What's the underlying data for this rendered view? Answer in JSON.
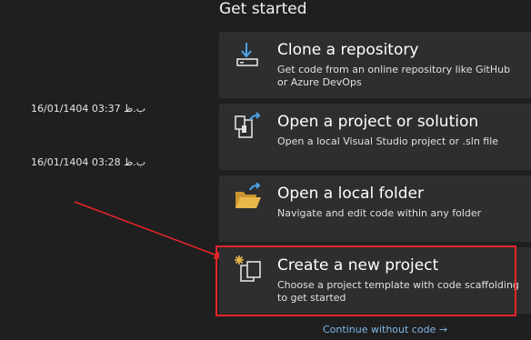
{
  "get_started": {
    "title": "Get started",
    "cards": [
      {
        "title": "Clone a repository",
        "desc": "Get code from an online repository like GitHub or Azure DevOps",
        "icon": "clone-download-icon"
      },
      {
        "title": "Open a project or solution",
        "desc": "Open a local Visual Studio project or .sln file",
        "icon": "open-project-icon"
      },
      {
        "title": "Open a local folder",
        "desc": "Navigate and edit code within any folder",
        "icon": "open-folder-icon"
      },
      {
        "title": "Create a new project",
        "desc": "Choose a project template with code scaffolding to get started",
        "icon": "new-project-icon"
      }
    ],
    "continue_label": "Continue without code →"
  },
  "recent": [
    {
      "timestamp": "16/01/1404 03:37 ب.ظ"
    },
    {
      "timestamp": "16/01/1404 03:28 ب.ظ"
    }
  ],
  "colors": {
    "background": "#1f1f1f",
    "card": "#2e2e2e",
    "link": "#7fb8ea",
    "annotation_red": "#e8242a",
    "icon_blue": "#4aa3e8",
    "folder_yellow": "#e8b84a"
  }
}
